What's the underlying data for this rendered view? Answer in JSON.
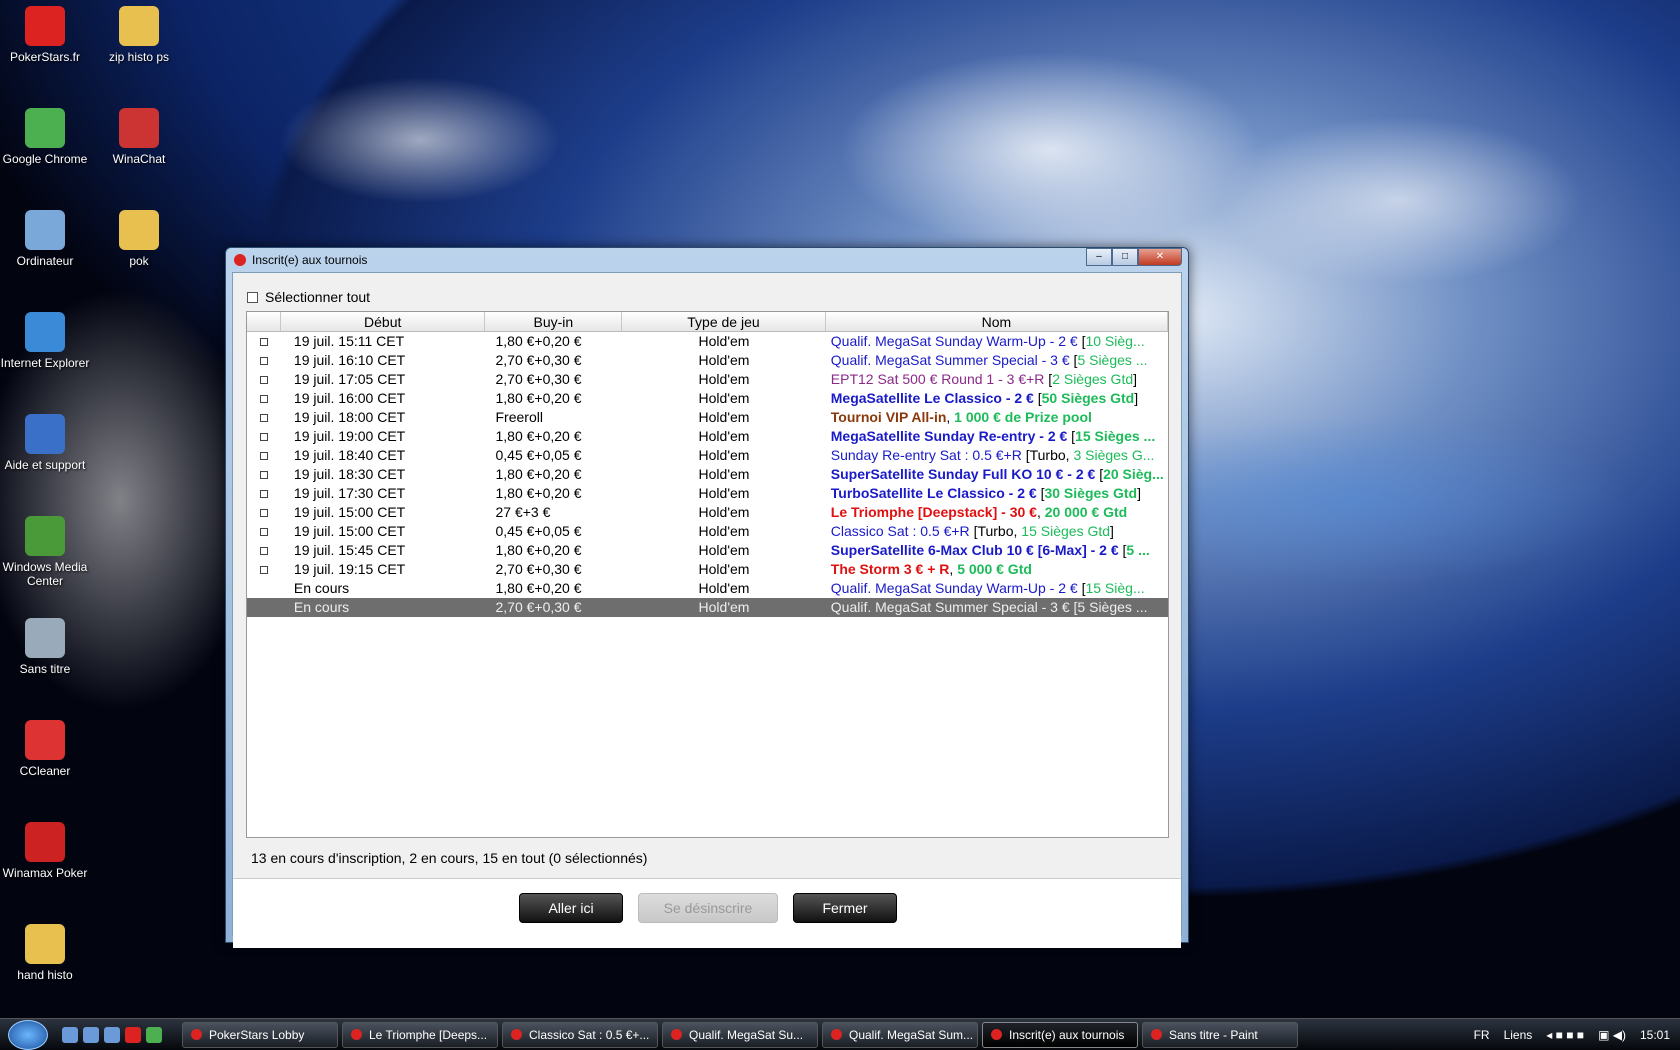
{
  "desktop_icons": [
    {
      "label": "PokerStars.fr",
      "color": "#d22"
    },
    {
      "label": "zip histo ps",
      "color": "#e8c050"
    },
    {
      "label": "Google Chrome",
      "color": "#4caf50"
    },
    {
      "label": "WinaChat",
      "color": "#c33"
    },
    {
      "label": "Ordinateur",
      "color": "#7aa8d8"
    },
    {
      "label": "pok",
      "color": "#e8c050"
    },
    {
      "label": "Internet Explorer",
      "color": "#3a8ad8"
    },
    {
      "label": "Aide et support",
      "color": "#3a70c8"
    },
    {
      "label": "Windows Media Center",
      "color": "#4a9a3a"
    },
    {
      "label": "Sans titre",
      "color": "#9ab"
    },
    {
      "label": "CCleaner",
      "color": "#d33"
    },
    {
      "label": "Winamax Poker",
      "color": "#c22"
    },
    {
      "label": "hand histo",
      "color": "#e8c050"
    }
  ],
  "dialog": {
    "title": "Inscrit(e) aux tournois",
    "select_all": "Sélectionner tout",
    "columns": [
      "Début",
      "Buy-in",
      "Type de jeu",
      "Nom"
    ],
    "rows": [
      {
        "check": true,
        "start": "19 juil. 15:11 CET",
        "buyin": "1,80 €+0,20 €",
        "type": "Hold'em",
        "name": [
          {
            "t": "Qualif. MegaSat Sunday Warm-Up - 2 € ",
            "c": "#1a1ac8"
          },
          {
            "t": "[",
            "c": "#000"
          },
          {
            "t": "10 Sièg...",
            "c": "#1dbb5a"
          }
        ]
      },
      {
        "check": true,
        "start": "19 juil. 16:10 CET",
        "buyin": "2,70 €+0,30 €",
        "type": "Hold'em",
        "name": [
          {
            "t": "Qualif. MegaSat Summer Special - 3 € ",
            "c": "#1a1ac8"
          },
          {
            "t": "[",
            "c": "#000"
          },
          {
            "t": "5 Sièges ...",
            "c": "#1dbb5a"
          }
        ]
      },
      {
        "check": true,
        "start": "19 juil. 17:05 CET",
        "buyin": "2,70 €+0,30 €",
        "type": "Hold'em",
        "name": [
          {
            "t": "EPT12 Sat 500 € Round 1 - 3 €+R ",
            "c": "#8a2a8a"
          },
          {
            "t": "[",
            "c": "#000"
          },
          {
            "t": "2 Sièges Gtd",
            "c": "#1dbb5a"
          },
          {
            "t": "]",
            "c": "#000"
          }
        ]
      },
      {
        "check": true,
        "start": "19 juil. 16:00 CET",
        "buyin": "1,80 €+0,20 €",
        "type": "Hold'em",
        "name": [
          {
            "t": "MegaSatellite Le Classico - 2 € ",
            "c": "#1a1ac8",
            "b": true
          },
          {
            "t": "[",
            "c": "#000"
          },
          {
            "t": "50 Sièges Gtd",
            "c": "#1dbb5a",
            "b": true
          },
          {
            "t": "]",
            "c": "#000"
          }
        ]
      },
      {
        "check": true,
        "start": "19 juil. 18:00 CET",
        "buyin": "Freeroll",
        "type": "Hold'em",
        "name": [
          {
            "t": "Tournoi VIP All-in",
            "c": "#8a3a0a",
            "b": true
          },
          {
            "t": ", ",
            "c": "#000"
          },
          {
            "t": "1 000 € de Prize pool",
            "c": "#1dbb5a",
            "b": true
          }
        ]
      },
      {
        "check": true,
        "start": "19 juil. 19:00 CET",
        "buyin": "1,80 €+0,20 €",
        "type": "Hold'em",
        "name": [
          {
            "t": "MegaSatellite Sunday Re-entry - 2 € ",
            "c": "#1a1ac8",
            "b": true
          },
          {
            "t": "[",
            "c": "#000"
          },
          {
            "t": "15 Sièges ...",
            "c": "#1dbb5a",
            "b": true
          }
        ]
      },
      {
        "check": true,
        "start": "19 juil. 18:40 CET",
        "buyin": "0,45 €+0,05 €",
        "type": "Hold'em",
        "name": [
          {
            "t": "Sunday Re-entry Sat : 0.5 €+R  ",
            "c": "#1a1ac8"
          },
          {
            "t": "[Turbo, ",
            "c": "#000"
          },
          {
            "t": "3 Sièges G...",
            "c": "#1dbb5a"
          }
        ]
      },
      {
        "check": true,
        "start": "19 juil. 18:30 CET",
        "buyin": "1,80 €+0,20 €",
        "type": "Hold'em",
        "name": [
          {
            "t": "SuperSatellite Sunday Full KO 10 € - 2 € ",
            "c": "#1a1ac8",
            "b": true
          },
          {
            "t": "[",
            "c": "#000"
          },
          {
            "t": "20 Sièg...",
            "c": "#1dbb5a",
            "b": true
          }
        ]
      },
      {
        "check": true,
        "start": "19 juil. 17:30 CET",
        "buyin": "1,80 €+0,20 €",
        "type": "Hold'em",
        "name": [
          {
            "t": "TurboSatellite Le Classico - 2 € ",
            "c": "#1a1ac8",
            "b": true
          },
          {
            "t": "[",
            "c": "#000"
          },
          {
            "t": "30 Sièges Gtd",
            "c": "#1dbb5a",
            "b": true
          },
          {
            "t": "]",
            "c": "#000"
          }
        ]
      },
      {
        "check": true,
        "start": "19 juil. 15:00 CET",
        "buyin": "27 €+3 €",
        "type": "Hold'em",
        "name": [
          {
            "t": "Le Triomphe [Deepstack] - 30 €",
            "c": "#e01010",
            "b": true
          },
          {
            "t": ", ",
            "c": "#000"
          },
          {
            "t": "20 000 € Gtd",
            "c": "#1dbb5a",
            "b": true
          }
        ]
      },
      {
        "check": true,
        "start": "19 juil. 15:00 CET",
        "buyin": "0,45 €+0,05 €",
        "type": "Hold'em",
        "name": [
          {
            "t": "Classico Sat : 0.5 €+R  ",
            "c": "#1a1ac8"
          },
          {
            "t": "[Turbo, ",
            "c": "#000"
          },
          {
            "t": "15 Sièges Gtd",
            "c": "#1dbb5a"
          },
          {
            "t": "]",
            "c": "#000"
          }
        ]
      },
      {
        "check": true,
        "start": "19 juil. 15:45 CET",
        "buyin": "1,80 €+0,20 €",
        "type": "Hold'em",
        "name": [
          {
            "t": "SuperSatellite 6-Max Club 10 € [6-Max] - 2 € ",
            "c": "#1a1ac8",
            "b": true
          },
          {
            "t": "[",
            "c": "#000"
          },
          {
            "t": "5 ...",
            "c": "#1dbb5a",
            "b": true
          }
        ]
      },
      {
        "check": true,
        "start": "19 juil. 19:15 CET",
        "buyin": "2,70 €+0,30 €",
        "type": "Hold'em",
        "name": [
          {
            "t": "The Storm 3 € + R",
            "c": "#e01010",
            "b": true
          },
          {
            "t": ", ",
            "c": "#000"
          },
          {
            "t": "5 000 € Gtd",
            "c": "#1dbb5a",
            "b": true
          }
        ]
      },
      {
        "check": false,
        "start": "En cours",
        "buyin": "1,80 €+0,20 €",
        "type": "Hold'em",
        "name": [
          {
            "t": "Qualif. MegaSat Sunday Warm-Up - 2 € ",
            "c": "#1a1ac8"
          },
          {
            "t": "[",
            "c": "#000"
          },
          {
            "t": "15 Sièg...",
            "c": "#1dbb5a"
          }
        ]
      },
      {
        "check": false,
        "selected": true,
        "start": "En cours",
        "buyin": "2,70 €+0,30 €",
        "type": "Hold'em",
        "name": [
          {
            "t": "Qualif. MegaSat Summer Special - 3 € [5 Sièges ...",
            "c": "#eee"
          }
        ]
      }
    ],
    "status": "13 en cours d'inscription, 2 en cours, 15 en tout (0 sélectionnés)",
    "buttons": {
      "go": "Aller ici",
      "unregister": "Se désinscrire",
      "close": "Fermer"
    }
  },
  "taskbar": {
    "items": [
      "PokerStars Lobby",
      "Le Triomphe [Deeps...",
      "Classico Sat : 0.5 €+...",
      "Qualif. MegaSat Su...",
      "Qualif. MegaSat Sum...",
      "Inscrit(e) aux tournois",
      "Sans titre - Paint"
    ],
    "active_index": 5,
    "lang": "FR",
    "links": "Liens",
    "clock": "15:01"
  }
}
